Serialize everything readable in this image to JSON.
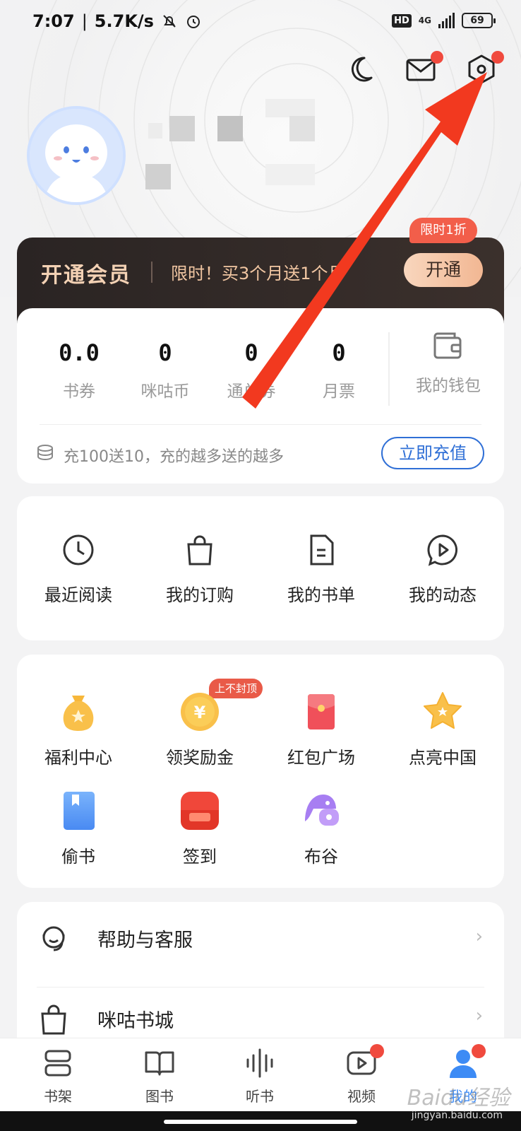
{
  "status_bar": {
    "time": "7:07",
    "speed": "5.7K/s",
    "network": "4G",
    "hd": "HD",
    "battery": "69"
  },
  "header": {
    "icons": [
      "moon-icon",
      "mail-icon",
      "settings-icon"
    ]
  },
  "vip": {
    "title": "开通会员",
    "promo": "限时！买3个月送1个月",
    "button": "开通",
    "badge": "限时1折"
  },
  "wallet": {
    "stats": [
      {
        "value": "0.0",
        "label": "书券"
      },
      {
        "value": "0",
        "label": "咪咕币"
      },
      {
        "value": "0",
        "label": "通兑券"
      },
      {
        "value": "0",
        "label": "月票"
      }
    ],
    "wallet_label": "我的钱包",
    "recharge_text": "充100送10，充的越多送的越多",
    "recharge_button": "立即充值"
  },
  "quick_links": [
    {
      "label": "最近阅读",
      "icon": "clock-icon"
    },
    {
      "label": "我的订购",
      "icon": "shopping-bag-icon"
    },
    {
      "label": "我的书单",
      "icon": "document-icon"
    },
    {
      "label": "我的动态",
      "icon": "play-bubble-icon"
    }
  ],
  "welfare": {
    "hot_badge": "上不封顶",
    "items": [
      {
        "label": "福利中心",
        "icon": "money-bag-icon"
      },
      {
        "label": "领奖励金",
        "icon": "yen-coin-icon"
      },
      {
        "label": "红包广场",
        "icon": "red-envelope-icon"
      },
      {
        "label": "点亮中国",
        "icon": "star-icon"
      },
      {
        "label": "偷书",
        "icon": "book-icon"
      },
      {
        "label": "签到",
        "icon": "checkin-icon"
      },
      {
        "label": "布谷",
        "icon": "bird-icon"
      }
    ]
  },
  "menu": [
    {
      "label": "帮助与客服",
      "icon": "customer-service-icon"
    },
    {
      "label": "咪咕书城",
      "icon": "bag-icon"
    }
  ],
  "bottom_nav": [
    {
      "label": "书架",
      "icon": "bookshelf-icon"
    },
    {
      "label": "图书",
      "icon": "open-book-icon"
    },
    {
      "label": "听书",
      "icon": "audio-wave-icon"
    },
    {
      "label": "视频",
      "icon": "video-icon"
    },
    {
      "label": "我的",
      "icon": "profile-icon"
    }
  ],
  "watermark": "Baidu经验",
  "watermark_sub": "jingyan.baidu.com",
  "colors": {
    "accent_blue": "#2f6fd6",
    "badge_red": "#f04a3e",
    "vip_gold": "#f3d1b4",
    "arrow_red": "#f2391f"
  }
}
